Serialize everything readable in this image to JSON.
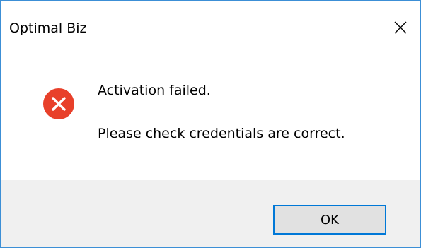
{
  "window": {
    "title": "Optimal Biz",
    "close_icon": "close-icon"
  },
  "message": {
    "icon": "error-icon",
    "line1": "Activation failed.",
    "line2": "Please check credentials are correct."
  },
  "buttons": {
    "ok_label": "OK"
  },
  "colors": {
    "border": "#3c8fd6",
    "error_red": "#e8402a",
    "footer_bg": "#f0f0f0",
    "button_bg": "#e1e1e1",
    "button_focus": "#0078d7"
  }
}
